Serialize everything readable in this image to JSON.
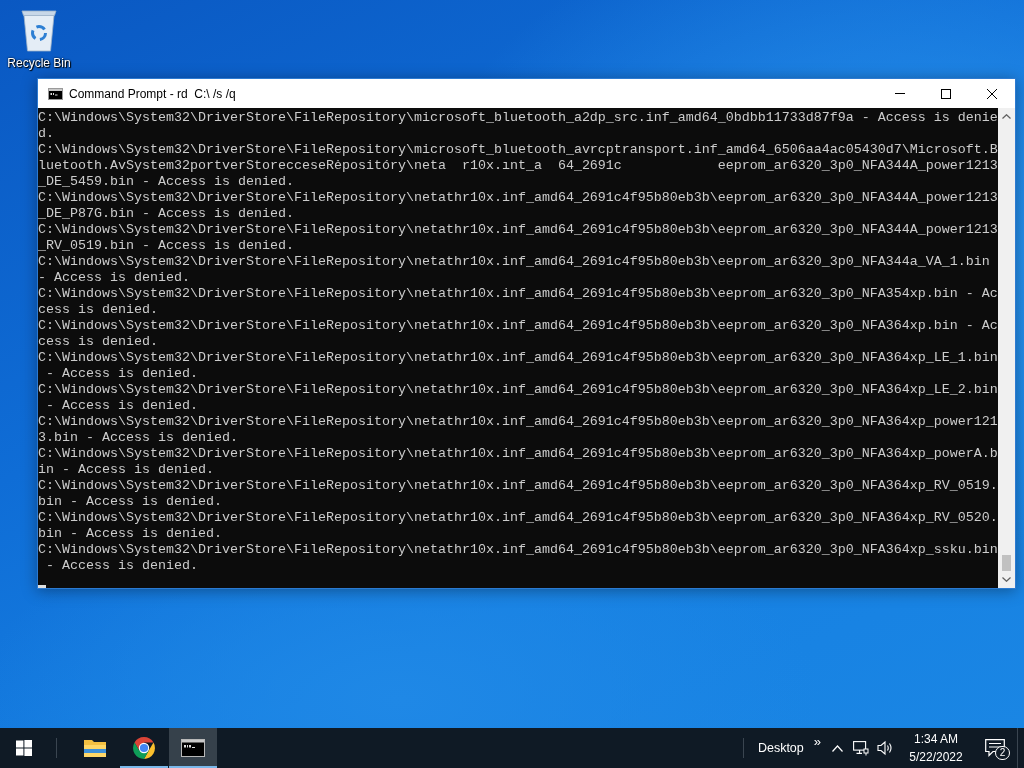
{
  "desktop": {
    "icons": [
      {
        "label": "Recycle Bin"
      }
    ]
  },
  "window": {
    "title": "Command Prompt - rd  C:\\ /s /q",
    "lines": [
      "C:\\Windows\\System32\\DriverStore\\FileRepository\\microsoft_bluetooth_a2dp_src.inf_amd64_0bdbb11733d87f9a - Access is denie",
      "d.",
      "C:\\Windows\\System32\\DriverStore\\FileRepository\\microsoft_bluetooth_avrcptransport.inf_amd64_6506aa4ac05430d7\\Microsoft.B",
      "luetooth.AvSystem32portverStorecceseRėpositóry\\neta  r10x.ınt_a  64_2691c            eeprom_ar6320_3p0_NFA344A_power1213",
      "_DE_5459.bin - Access is denied.",
      "C:\\Windows\\System32\\DriverStore\\FileRepository\\netathr10x.inf_amd64_2691c4f95b80eb3b\\eeprom_ar6320_3p0_NFA344A_power1213",
      "_DE_P87G.bin - Access is denied.",
      "C:\\Windows\\System32\\DriverStore\\FileRepository\\netathr10x.inf_amd64_2691c4f95b80eb3b\\eeprom_ar6320_3p0_NFA344A_power1213",
      "_RV_0519.bin - Access is denied.",
      "C:\\Windows\\System32\\DriverStore\\FileRepository\\netathr10x.inf_amd64_2691c4f95b80eb3b\\eeprom_ar6320_3p0_NFA344a_VA_1.bin",
      "- Access is denied.",
      "C:\\Windows\\System32\\DriverStore\\FileRepository\\netathr10x.inf_amd64_2691c4f95b80eb3b\\eeprom_ar6320_3p0_NFA354xp.bin - Ac",
      "cess is denied.",
      "C:\\Windows\\System32\\DriverStore\\FileRepository\\netathr10x.inf_amd64_2691c4f95b80eb3b\\eeprom_ar6320_3p0_NFA364xp.bin - Ac",
      "cess is denied.",
      "C:\\Windows\\System32\\DriverStore\\FileRepository\\netathr10x.inf_amd64_2691c4f95b80eb3b\\eeprom_ar6320_3p0_NFA364xp_LE_1.bin",
      " - Access is denied.",
      "C:\\Windows\\System32\\DriverStore\\FileRepository\\netathr10x.inf_amd64_2691c4f95b80eb3b\\eeprom_ar6320_3p0_NFA364xp_LE_2.bin",
      " - Access is denied.",
      "C:\\Windows\\System32\\DriverStore\\FileRepository\\netathr10x.inf_amd64_2691c4f95b80eb3b\\eeprom_ar6320_3p0_NFA364xp_power121",
      "3.bin - Access is denied.",
      "C:\\Windows\\System32\\DriverStore\\FileRepository\\netathr10x.inf_amd64_2691c4f95b80eb3b\\eeprom_ar6320_3p0_NFA364xp_powerA.b",
      "in - Access is denied.",
      "C:\\Windows\\System32\\DriverStore\\FileRepository\\netathr10x.inf_amd64_2691c4f95b80eb3b\\eeprom_ar6320_3p0_NFA364xp_RV_0519.",
      "bin - Access is denied.",
      "C:\\Windows\\System32\\DriverStore\\FileRepository\\netathr10x.inf_amd64_2691c4f95b80eb3b\\eeprom_ar6320_3p0_NFA364xp_RV_0520.",
      "bin - Access is denied.",
      "C:\\Windows\\System32\\DriverStore\\FileRepository\\netathr10x.inf_amd64_2691c4f95b80eb3b\\eeprom_ar6320_3p0_NFA364xp_ssku.bin",
      " - Access is denied."
    ]
  },
  "taskbar": {
    "apps": [
      {
        "kind": "folder",
        "running": false,
        "selected": false
      },
      {
        "kind": "browser",
        "running": true,
        "selected": false
      },
      {
        "kind": "terminal",
        "running": true,
        "selected": true
      }
    ],
    "toolbar": {
      "label": "Desktop",
      "overflow": "»"
    },
    "clock": {
      "time": "1:34 AM",
      "date": "5/22/2022"
    },
    "notifications": {
      "count": "2"
    }
  }
}
